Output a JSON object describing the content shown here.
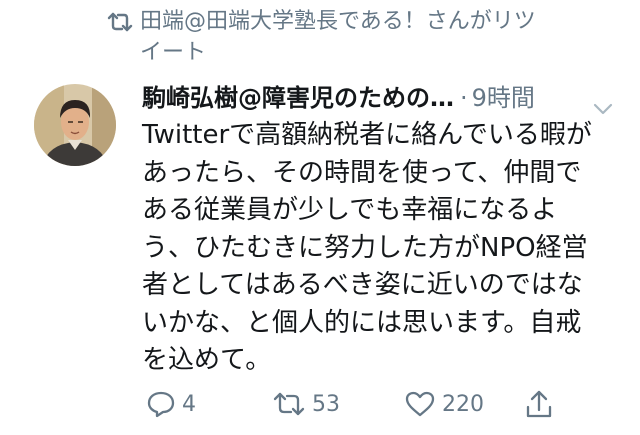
{
  "retweet_context": {
    "icon": "retweet-icon",
    "text": "田端@田端大学塾長である！さんがリツイート"
  },
  "author": {
    "name": "駒崎弘樹@障害児のための…",
    "avatar": "avatar-photo"
  },
  "timestamp": "9時間",
  "body": "Twitterで高額納税者に絡んでいる暇が\nあったら、その時間を使って、仲間で\nある従業員が少しでも幸福になるよ\nう、ひたむきに努力した方がNPO経営\n者としてはあるべき姿に近いのではな\nいかな、と個人的には思います。自戒\nを込めて。",
  "actions": {
    "reply": {
      "icon": "reply-icon",
      "count": "4"
    },
    "retweet": {
      "icon": "retweet-icon",
      "count": "53"
    },
    "like": {
      "icon": "heart-icon",
      "count": "220"
    },
    "share": {
      "icon": "share-icon"
    }
  },
  "colors": {
    "secondary_text": "#657786",
    "primary_text": "#14171a"
  }
}
